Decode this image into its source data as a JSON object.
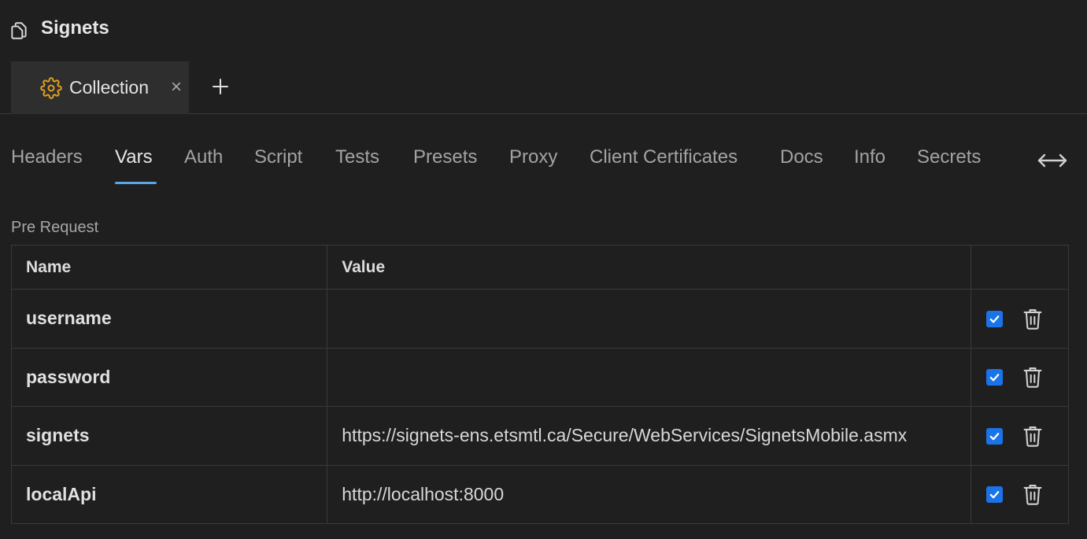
{
  "app": {
    "title": "Signets",
    "icon": "copy-icon"
  },
  "tabs": [
    {
      "label": "Collection",
      "icon": "gear-icon",
      "icon_color": "#e0a020",
      "active": true
    }
  ],
  "subtabs": [
    {
      "label": "Headers"
    },
    {
      "label": "Vars",
      "active": true
    },
    {
      "label": "Auth"
    },
    {
      "label": "Script"
    },
    {
      "label": "Tests"
    },
    {
      "label": "Presets"
    },
    {
      "label": "Proxy"
    },
    {
      "label": "Client Certificates"
    },
    {
      "label": "Docs"
    },
    {
      "label": "Info"
    },
    {
      "label": "Secrets"
    }
  ],
  "section": {
    "label": "Pre Request"
  },
  "table": {
    "headers": {
      "name": "Name",
      "value": "Value"
    },
    "rows": [
      {
        "name": "username",
        "value": "",
        "enabled": true
      },
      {
        "name": "password",
        "value": "",
        "enabled": true
      },
      {
        "name": "signets",
        "value": "https://signets-ens.etsmtl.ca/Secure/WebServices/SignetsMobile.asmx",
        "enabled": true
      },
      {
        "name": "localApi",
        "value": "http://localhost:8000",
        "enabled": true
      }
    ]
  },
  "colors": {
    "background": "#1f1f1f",
    "accent": "#5aa5e6",
    "checkbox": "#1a73e8"
  }
}
